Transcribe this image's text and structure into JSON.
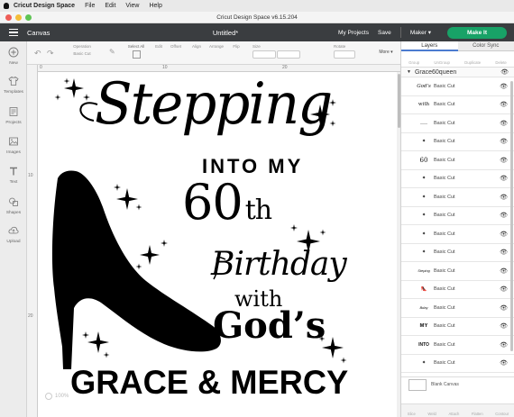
{
  "menubar": {
    "items": [
      "Cricut Design Space",
      "File",
      "Edit",
      "View",
      "Help"
    ]
  },
  "titlebar": {
    "title": "Cricut Design Space  v6.15.204"
  },
  "header": {
    "canvas_label": "Canvas",
    "doc_title": "Untitled*",
    "my_projects": "My Projects",
    "save": "Save",
    "machine": "Maker",
    "make_it": "Make It",
    "make_it_color": "#18a267"
  },
  "toolbar": {
    "operation_label": "Operation",
    "operation_value": "Basic Cut",
    "select_all": "Select All",
    "edit": "Edit",
    "offset": "Offset",
    "align": "Align",
    "arrange": "Arrange",
    "flip": "Flip",
    "size": "Size",
    "rotate": "Rotate",
    "more": "More ▾"
  },
  "sidebar": {
    "items": [
      {
        "label": "New",
        "icon": "plus-icon"
      },
      {
        "label": "Templates",
        "icon": "shirt-icon"
      },
      {
        "label": "Projects",
        "icon": "projects-icon"
      },
      {
        "label": "Images",
        "icon": "image-icon"
      },
      {
        "label": "Text",
        "icon": "text-icon"
      },
      {
        "label": "Shapes",
        "icon": "shapes-icon"
      },
      {
        "label": "Upload",
        "icon": "upload-icon"
      }
    ]
  },
  "rulers": {
    "top": [
      "0",
      "10",
      "20"
    ],
    "left": [
      "10",
      "20"
    ]
  },
  "zoom": {
    "value": "100%"
  },
  "design": {
    "line1": "Stepping",
    "line2": "INTO MY",
    "line3_num": "60",
    "line3_suffix": "th",
    "line4": "Birthday",
    "line5": "with",
    "line6": "God’s",
    "line7": "GRACE & MERCY"
  },
  "panel": {
    "tab_layers": "Layers",
    "tab_color_sync": "Color Sync",
    "tools": [
      "Group",
      "UnGroup",
      "Duplicate",
      "Delete"
    ],
    "group_name": "Grace60queen",
    "layers": [
      {
        "thumb": "God's",
        "label": "Basic Cut"
      },
      {
        "thumb": "with",
        "label": "Basic Cut"
      },
      {
        "thumb": "——",
        "label": "Basic Cut"
      },
      {
        "thumb": "✦",
        "label": "Basic Cut"
      },
      {
        "thumb": "60",
        "label": "Basic Cut"
      },
      {
        "thumb": "✦",
        "label": "Basic Cut"
      },
      {
        "thumb": "✦",
        "label": "Basic Cut"
      },
      {
        "thumb": "✦",
        "label": "Basic Cut"
      },
      {
        "thumb": "✦",
        "label": "Basic Cut"
      },
      {
        "thumb": "✦",
        "label": "Basic Cut"
      },
      {
        "thumb": "Steping",
        "label": "Basic Cut"
      },
      {
        "thumb": "👠",
        "label": "Basic Cut"
      },
      {
        "thumb": "Bday",
        "label": "Basic Cut"
      },
      {
        "thumb": "MY",
        "label": "Basic Cut"
      },
      {
        "thumb": "INTO",
        "label": "Basic Cut"
      },
      {
        "thumb": "✦",
        "label": "Basic Cut"
      }
    ],
    "blank_canvas": "Blank Canvas",
    "bottom_tools": [
      "Slice",
      "Weld",
      "Attach",
      "Flatten",
      "Contour"
    ]
  }
}
